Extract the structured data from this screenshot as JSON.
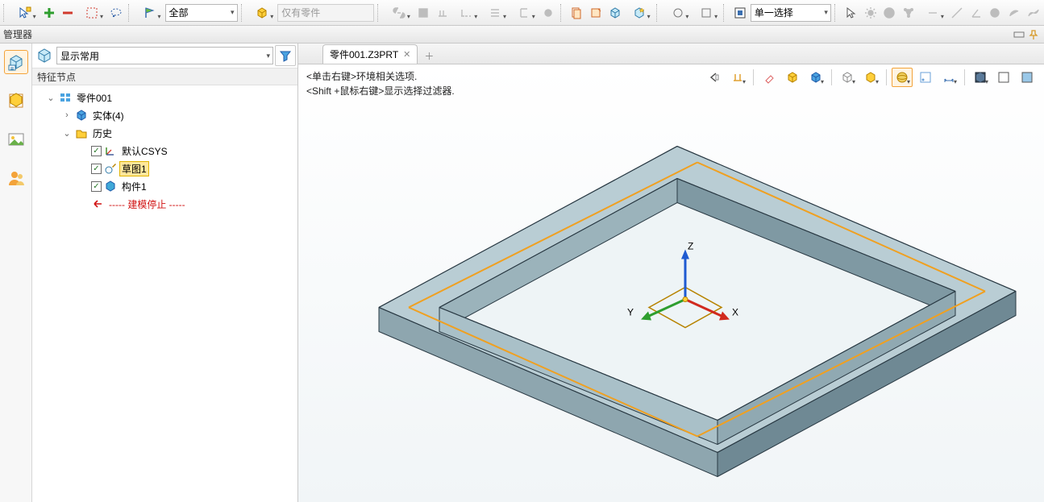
{
  "toolbar": {
    "filter_combo": "全部",
    "only_parts": "仅有零件",
    "select_mode": "单一选择"
  },
  "manager": {
    "title": "管理器",
    "display_combo": "显示常用",
    "section": "特征节点"
  },
  "tree": {
    "root": "零件001",
    "solids": "实体(4)",
    "history": "历史",
    "csys": "默认CSYS",
    "sketch": "草图1",
    "member": "构件1",
    "stop": "----- 建模停止 -----"
  },
  "tab": {
    "label": "零件001.Z3PRT"
  },
  "hint": {
    "line1": "<单击右键>环境相关选项.",
    "line2": "<Shift +鼠标右键>显示选择过滤器."
  },
  "axes": {
    "x": "X",
    "y": "Y",
    "z": "Z"
  }
}
